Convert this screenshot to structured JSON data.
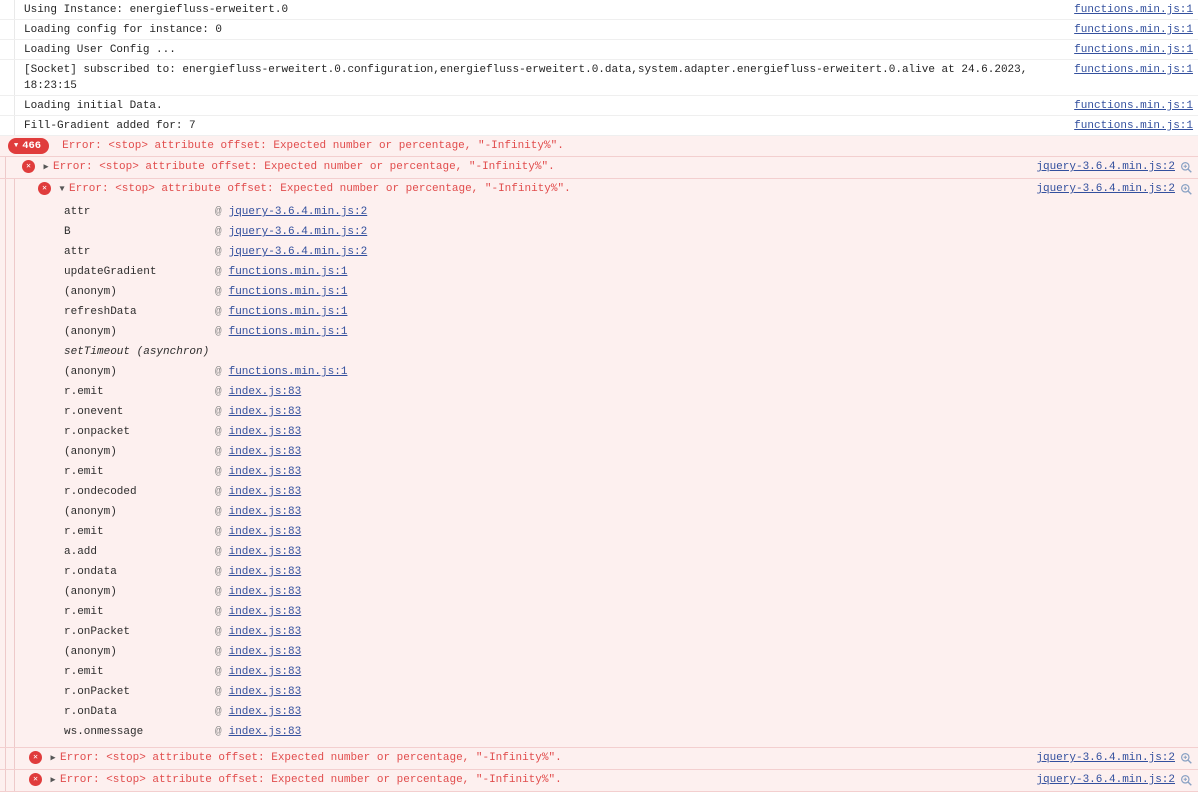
{
  "colors": {
    "accent_red": "#e03c3c",
    "error_text": "#e14c4c",
    "error_row_bg": "#fdf0ef",
    "link_blue": "#33509e",
    "magnifier_blue": "#8aa2c4"
  },
  "icons": {
    "badge_caret": "▼",
    "expand_collapsed": "▶",
    "expand_expanded": "▼",
    "error_x": "✕",
    "at": "@"
  },
  "console": {
    "logs": [
      {
        "text": "Using Instance: energiefluss-erweitert.0",
        "source": "functions.min.js:1"
      },
      {
        "text": "Loading config for instance: 0",
        "source": "functions.min.js:1"
      },
      {
        "text": "Loading User Config ...",
        "source": "functions.min.js:1"
      },
      {
        "text": "[Socket] subscribed to: energiefluss-erweitert.0.configuration,energiefluss-erweitert.0.data,system.adapter.energiefluss-erweitert.0.alive at 24.6.2023, 18:23:15",
        "source": "functions.min.js:1"
      },
      {
        "text": "Loading initial Data.",
        "source": "functions.min.js:1"
      },
      {
        "text": "Fill-Gradient added for: 7",
        "source": "functions.min.js:1"
      }
    ],
    "error_badge_count": "466",
    "error_text": "Error: <stop> attribute offset: Expected number or percentage, \"-Infinity%\".",
    "error_source": "jquery-3.6.4.min.js:2",
    "stack": [
      {
        "fn": "attr",
        "loc": "jquery-3.6.4.min.js:2"
      },
      {
        "fn": "B",
        "loc": "jquery-3.6.4.min.js:2"
      },
      {
        "fn": "attr",
        "loc": "jquery-3.6.4.min.js:2"
      },
      {
        "fn": "updateGradient",
        "loc": "functions.min.js:1"
      },
      {
        "fn": "(anonym)",
        "loc": "functions.min.js:1"
      },
      {
        "fn": "refreshData",
        "loc": "functions.min.js:1"
      },
      {
        "fn": "(anonym)",
        "loc": "functions.min.js:1"
      },
      {
        "fn": "setTimeout (asynchron)",
        "loc": ""
      },
      {
        "fn": "(anonym)",
        "loc": "functions.min.js:1"
      },
      {
        "fn": "r.emit",
        "loc": "index.js:83"
      },
      {
        "fn": "r.onevent",
        "loc": "index.js:83"
      },
      {
        "fn": "r.onpacket",
        "loc": "index.js:83"
      },
      {
        "fn": "(anonym)",
        "loc": "index.js:83"
      },
      {
        "fn": "r.emit",
        "loc": "index.js:83"
      },
      {
        "fn": "r.ondecoded",
        "loc": "index.js:83"
      },
      {
        "fn": "(anonym)",
        "loc": "index.js:83"
      },
      {
        "fn": "r.emit",
        "loc": "index.js:83"
      },
      {
        "fn": "a.add",
        "loc": "index.js:83"
      },
      {
        "fn": "r.ondata",
        "loc": "index.js:83"
      },
      {
        "fn": "(anonym)",
        "loc": "index.js:83"
      },
      {
        "fn": "r.emit",
        "loc": "index.js:83"
      },
      {
        "fn": "r.onPacket",
        "loc": "index.js:83"
      },
      {
        "fn": "(anonym)",
        "loc": "index.js:83"
      },
      {
        "fn": "r.emit",
        "loc": "index.js:83"
      },
      {
        "fn": "r.onPacket",
        "loc": "index.js:83"
      },
      {
        "fn": "r.onData",
        "loc": "index.js:83"
      },
      {
        "fn": "ws.onmessage",
        "loc": "index.js:83"
      }
    ]
  }
}
